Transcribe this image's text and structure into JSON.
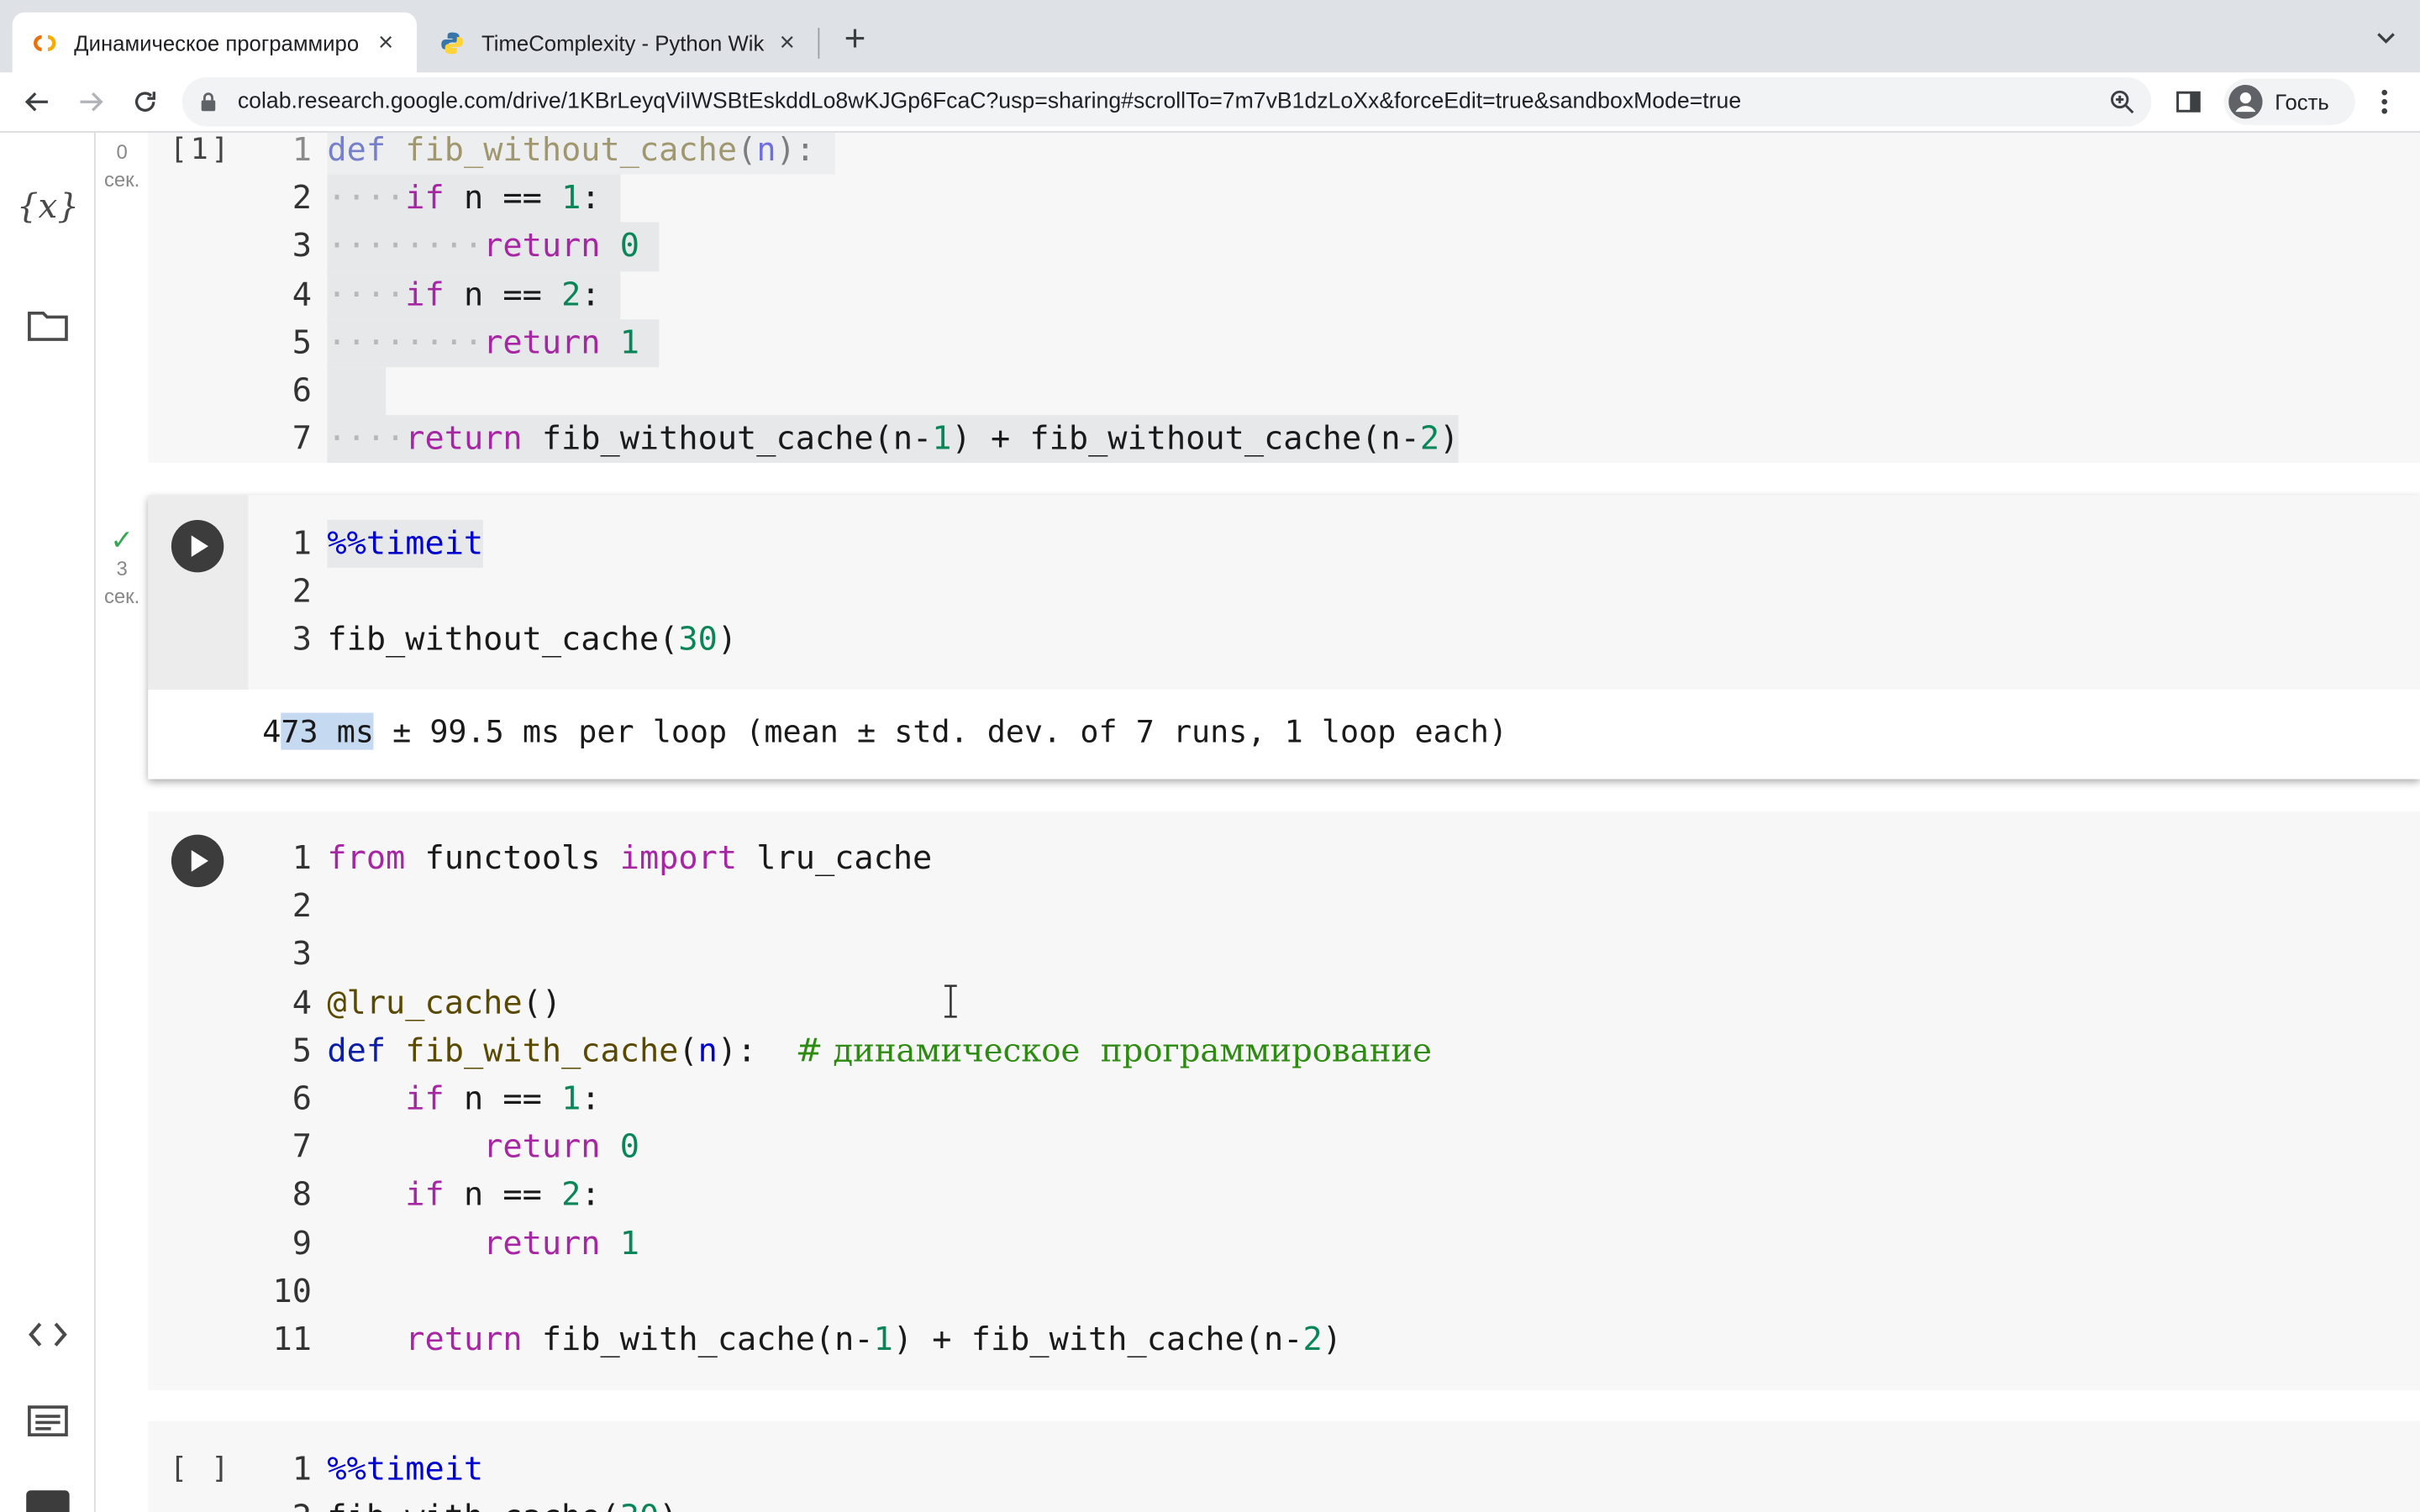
{
  "browser": {
    "tabs": [
      {
        "title": "Динамическое программиро",
        "active": true
      },
      {
        "title": "TimeComplexity - Python Wiki",
        "active": false
      }
    ],
    "url": "colab.research.google.com/drive/1KBrLeyqViIWSBtEskddLo8wKJGp6FcaC?usp=sharing#scrollTo=7m7vB1dzLoXx&forceEdit=true&sandboxMode=true",
    "profile_name": "Гость"
  },
  "sidebar": {
    "variables_label": "{x}"
  },
  "cells": {
    "cell1": {
      "exec_time": "0",
      "exec_unit": "сек.",
      "bracket": "[1]",
      "lines": [
        "1",
        "2",
        "3",
        "4",
        "5",
        "6",
        "7"
      ]
    },
    "cell2": {
      "exec_time": "3",
      "exec_unit": "сек.",
      "lines": [
        "1",
        "2",
        "3"
      ],
      "output": "473 ms ± 99.5 ms per loop (mean ± std. dev. of 7 runs, 1 loop each)",
      "output_pre": "4",
      "output_sel": "73 ms",
      "output_post": " ± 99.5 ms per loop (mean ± std. dev. of 7 runs, 1 loop each)"
    },
    "cell3": {
      "lines": [
        "1",
        "2",
        "3",
        "4",
        "5",
        "6",
        "7",
        "8",
        "9",
        "10",
        "11"
      ],
      "comment": "# динамическое  программирование"
    },
    "cell4": {
      "bracket": "[ ]",
      "lines": [
        "1",
        "2"
      ]
    }
  },
  "colors": {
    "keyword": "#a626a4",
    "number": "#098658",
    "magic": "#0000d0",
    "comment": "#2e8b12",
    "run_button": "#3c3c3c",
    "success_check": "#34a853"
  }
}
